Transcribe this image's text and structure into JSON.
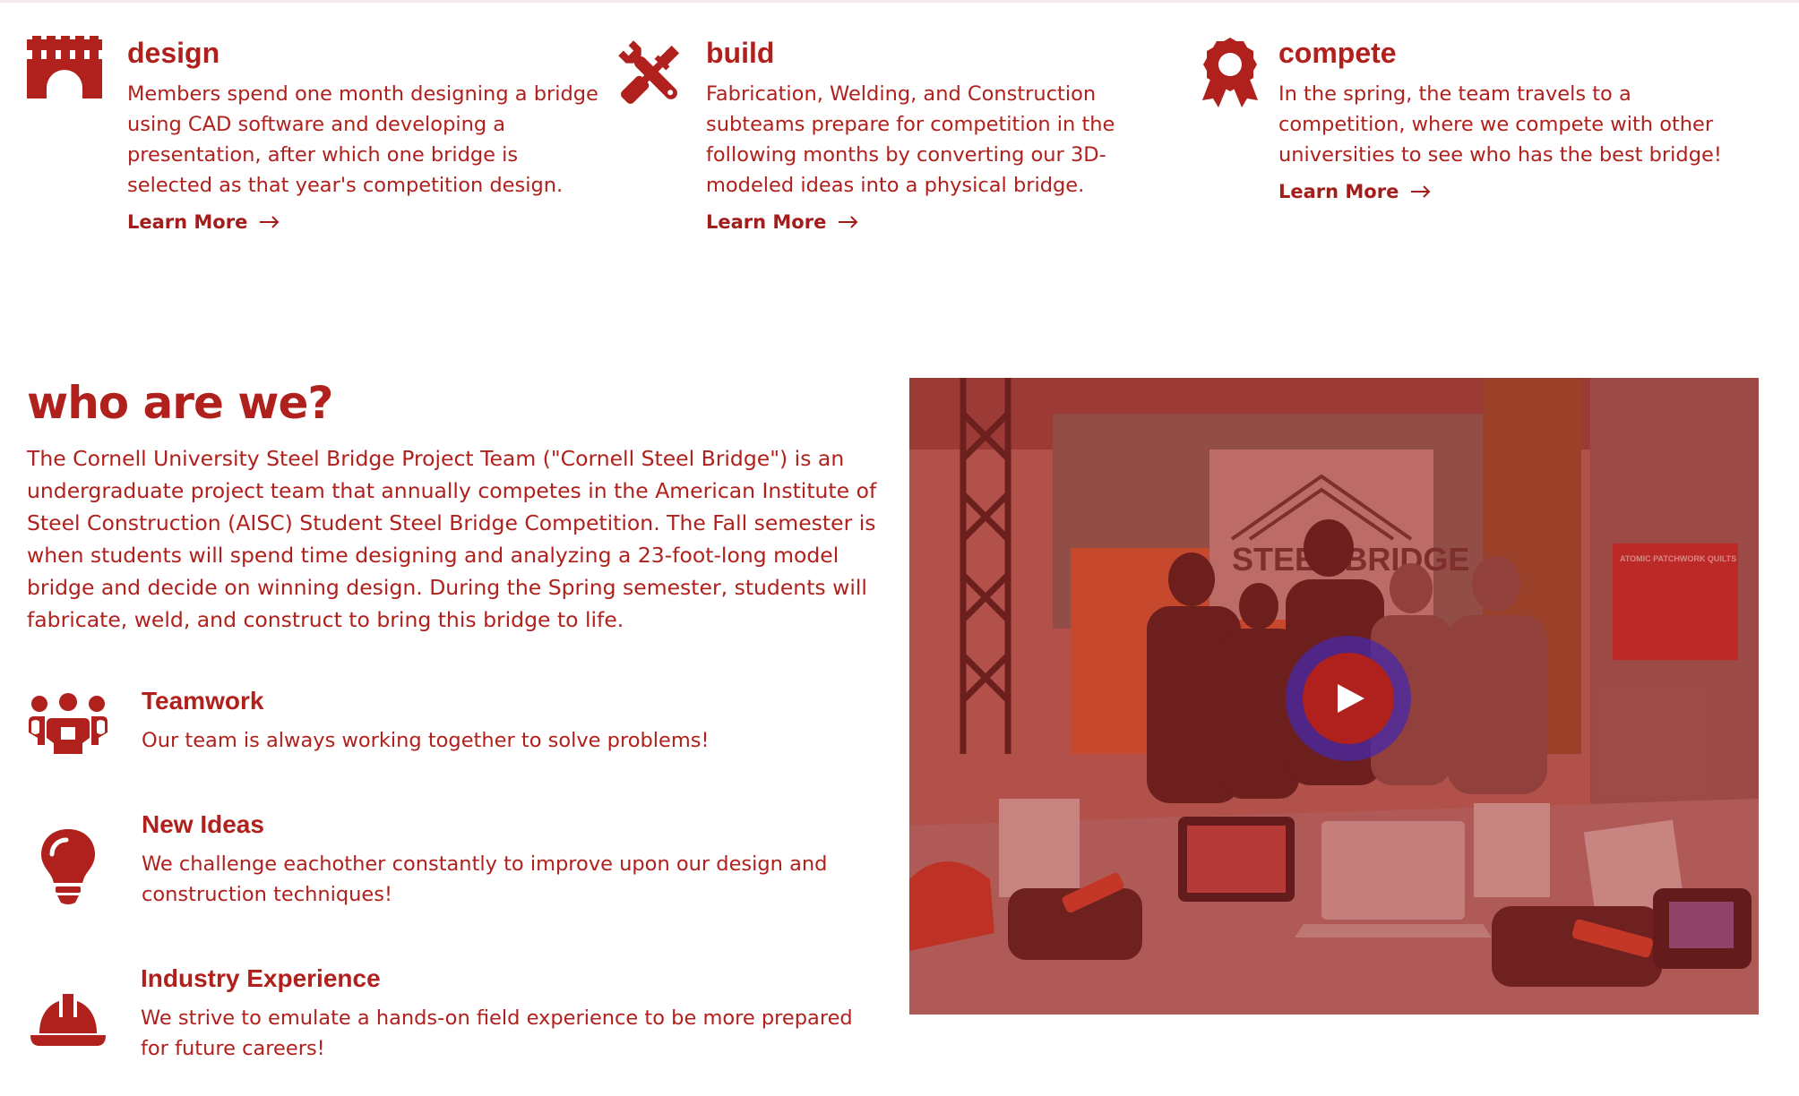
{
  "features": [
    {
      "title": "design",
      "text": "Members spend one month designing a bridge using CAD software and developing a presentation, after which one bridge is selected as that year's competition design.",
      "link": "Learn More",
      "icon": "bridge-icon"
    },
    {
      "title": "build",
      "text": "Fabrication, Welding, and Construction subteams prepare for competition in the following months by converting our 3D-modeled ideas into a physical bridge.",
      "link": "Learn More",
      "icon": "wrench-screwdriver-icon"
    },
    {
      "title": "compete",
      "text": "In the spring, the team travels to a competition, where we compete with other universities to see who has the best bridge!",
      "link": "Learn More",
      "icon": "award-icon"
    }
  ],
  "who": {
    "title": "who are we?",
    "text": "The Cornell University Steel Bridge Project Team (\"Cornell Steel Bridge\") is an undergraduate project team that annually competes in the American Institute of Steel Construction (AISC) Student Steel Bridge Competition. The Fall semester is when students will spend time designing and analyzing a 23-foot-long model bridge and decide on winning design. During the Spring semester, students will fabricate, weld, and construct to bring this bridge to life."
  },
  "values": [
    {
      "title": "Teamwork",
      "text": "Our team is always working together to solve problems!",
      "icon": "team-icon"
    },
    {
      "title": "New Ideas",
      "text": "We challenge eachother constantly to improve upon our design and construction techniques!",
      "icon": "lightbulb-icon"
    },
    {
      "title": "Industry Experience",
      "text": "We strive to emulate a hands-on field experience to be more prepared for future careers!",
      "icon": "hard-hat-icon"
    }
  ],
  "video": {
    "banner_text": "STEEL BRIDGE",
    "poster_title": "ATOMIC PATCHWORK QUILTS",
    "play_icon": "play-icon"
  },
  "colors": {
    "brand": "#b0201c",
    "play_ring": "#4628aa",
    "background": "#ffffff"
  }
}
